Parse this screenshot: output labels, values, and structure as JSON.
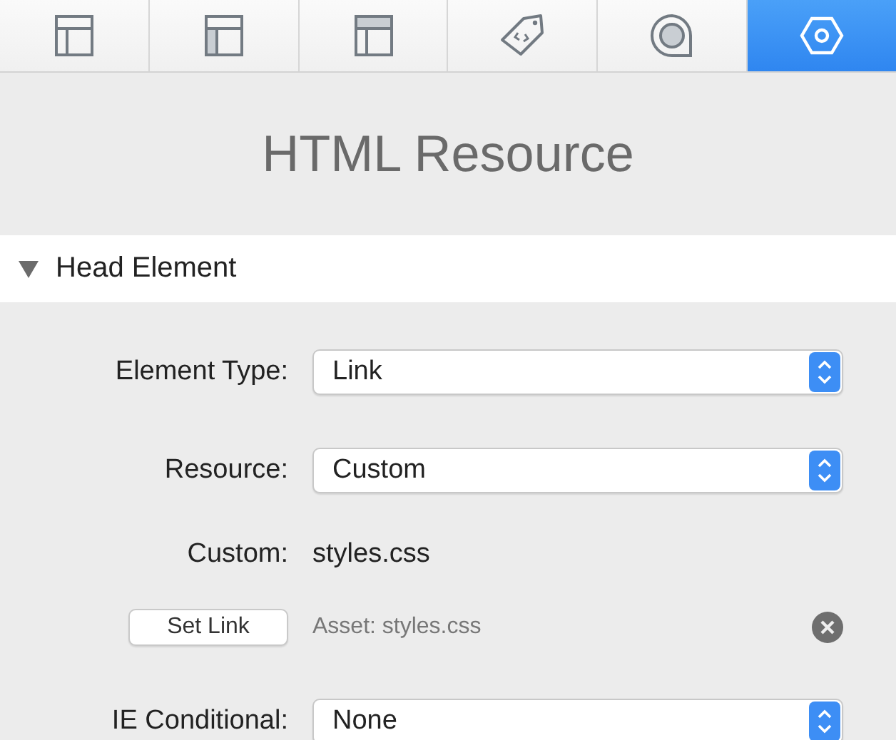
{
  "tabs": [
    {
      "kind": "layout",
      "selected": false
    },
    {
      "kind": "layout-side",
      "selected": false
    },
    {
      "kind": "layout-top",
      "selected": false
    },
    {
      "kind": "tag",
      "selected": false
    },
    {
      "kind": "target",
      "selected": false
    },
    {
      "kind": "hexagon",
      "selected": true
    }
  ],
  "title": "HTML Resource",
  "section": {
    "label": "Head Element",
    "expanded": true
  },
  "element_type": {
    "label": "Element Type:",
    "value": "Link"
  },
  "resource": {
    "label": "Resource:",
    "value": "Custom"
  },
  "custom": {
    "label": "Custom:",
    "value": "styles.css"
  },
  "set_link": {
    "button": "Set Link",
    "asset": "Asset: styles.css"
  },
  "ie_conditional": {
    "label": "IE Conditional:",
    "value": "None"
  }
}
